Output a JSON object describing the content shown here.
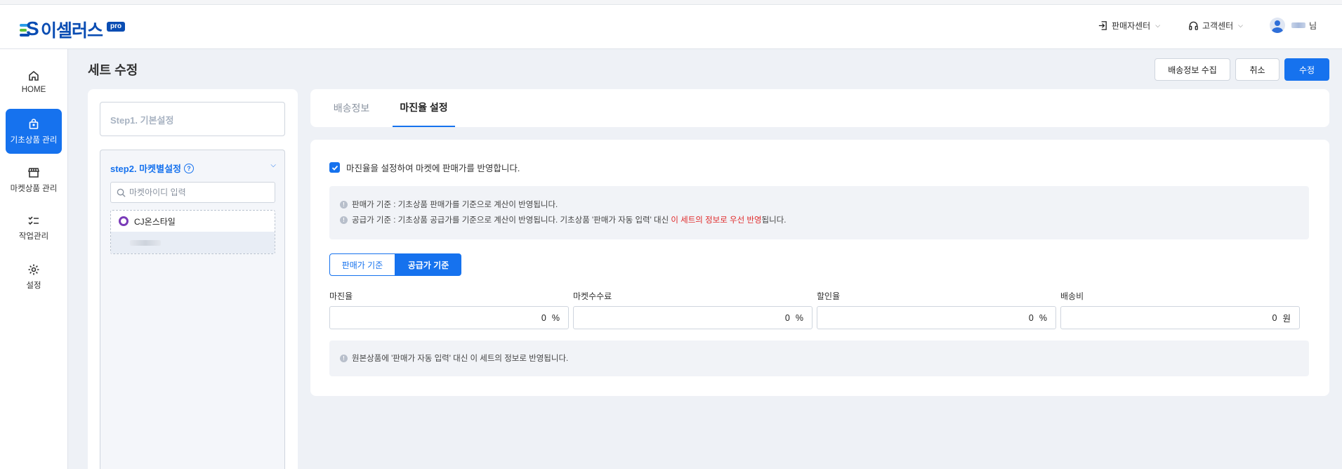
{
  "header": {
    "logo_text": "이셀러스",
    "logo_badge": "pro",
    "seller_center": "판매자센터",
    "customer_center": "고객센터",
    "user_suffix": "님"
  },
  "sidebar": {
    "items": [
      {
        "label": "HOME",
        "icon": "home-icon"
      },
      {
        "label": "기초상품 관리",
        "icon": "shopping-bag-icon",
        "active": true
      },
      {
        "label": "마켓상품 관리",
        "icon": "store-icon"
      },
      {
        "label": "작업관리",
        "icon": "checklist-icon"
      },
      {
        "label": "설정",
        "icon": "gear-icon"
      }
    ]
  },
  "page": {
    "title": "세트 수정",
    "actions": {
      "collect_shipping": "배송정보 수집",
      "cancel": "취소",
      "save": "수정"
    }
  },
  "left_panel": {
    "step1": "Step1. 기본설정",
    "step2": "step2. 마켓별설정",
    "search_placeholder": "마켓아이디 입력",
    "markets": [
      {
        "name": "CJ온스타일"
      }
    ]
  },
  "tabs": [
    {
      "label": "배송정보",
      "active": false
    },
    {
      "label": "마진율 설정",
      "active": true
    }
  ],
  "margin": {
    "checkbox_label": "마진율을 설정하여 마켓에 판매가를 반영합니다.",
    "checked": true,
    "info1": "판매가 기준 : 기초상품 판매가를 기준으로 계산이 반영됩니다.",
    "info2_a": "공급가 기준 : 기초상품 공급가를 기준으로 계산이 반영됩니다. 기초상품 '판매가 자동 입력' 대신 ",
    "info2_red": "이 세트의 정보로 우선 반영",
    "info2_b": "됩니다.",
    "basis_sale": "판매가 기준",
    "basis_supply": "공급가 기준",
    "selected_basis": "공급가 기준",
    "fields": [
      {
        "label": "마진율",
        "value": "0",
        "unit": "%"
      },
      {
        "label": "마켓수수료",
        "value": "0",
        "unit": "%"
      },
      {
        "label": "할인율",
        "value": "0",
        "unit": "%"
      },
      {
        "label": "배송비",
        "value": "0",
        "unit": "원"
      }
    ],
    "note": "원본상품에 '판매가 자동 입력' 대신 이 세트의 정보로 반영됩니다."
  },
  "colors": {
    "primary": "#1672ee",
    "brand": "#0a4db3",
    "highlight_red": "#e02a2a"
  }
}
